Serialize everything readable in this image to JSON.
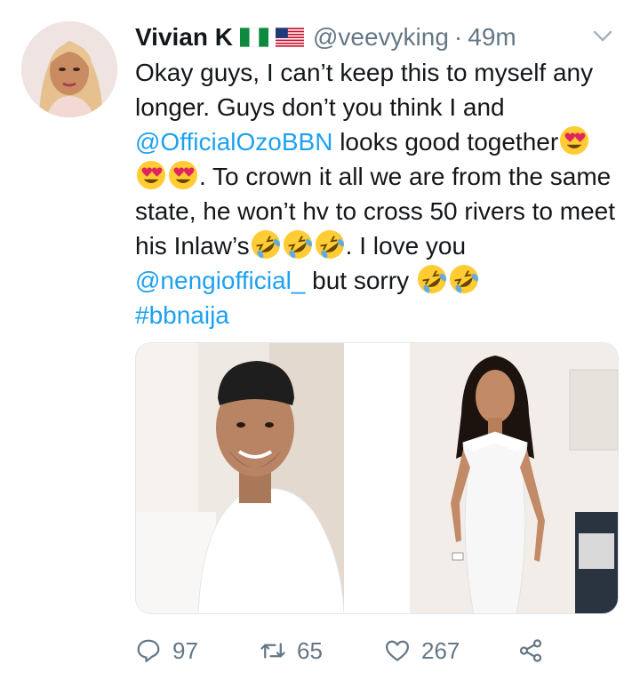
{
  "tweet": {
    "author_name": "Vivian K",
    "handle": "@veevyking",
    "separator": "·",
    "time": "49m",
    "text": {
      "p1": "Okay guys, I can’t keep this to myself any longer. Guys don’t you think I and ",
      "mention1": "@OfficialOzoBBN",
      "p2": " looks good together",
      "p3": ". To crown it all we are from the same state, he won’t hv to cross 50 rivers to meet his Inlaw’s",
      "p4": ". I love you ",
      "mention2": "@nengiofficial_",
      "p5": " but sorry ",
      "hashtag": "#bbnaija"
    },
    "flags": [
      "nigeria-flag-icon",
      "usa-flag-icon"
    ],
    "emojis": [
      "heart-eyes-emoji",
      "rolling-laughing-emoji"
    ],
    "colors": {
      "link": "#1da1f2",
      "secondary": "#657786",
      "text": "#14171a"
    }
  },
  "actions": {
    "replies": "97",
    "retweets": "65",
    "likes": "267"
  }
}
